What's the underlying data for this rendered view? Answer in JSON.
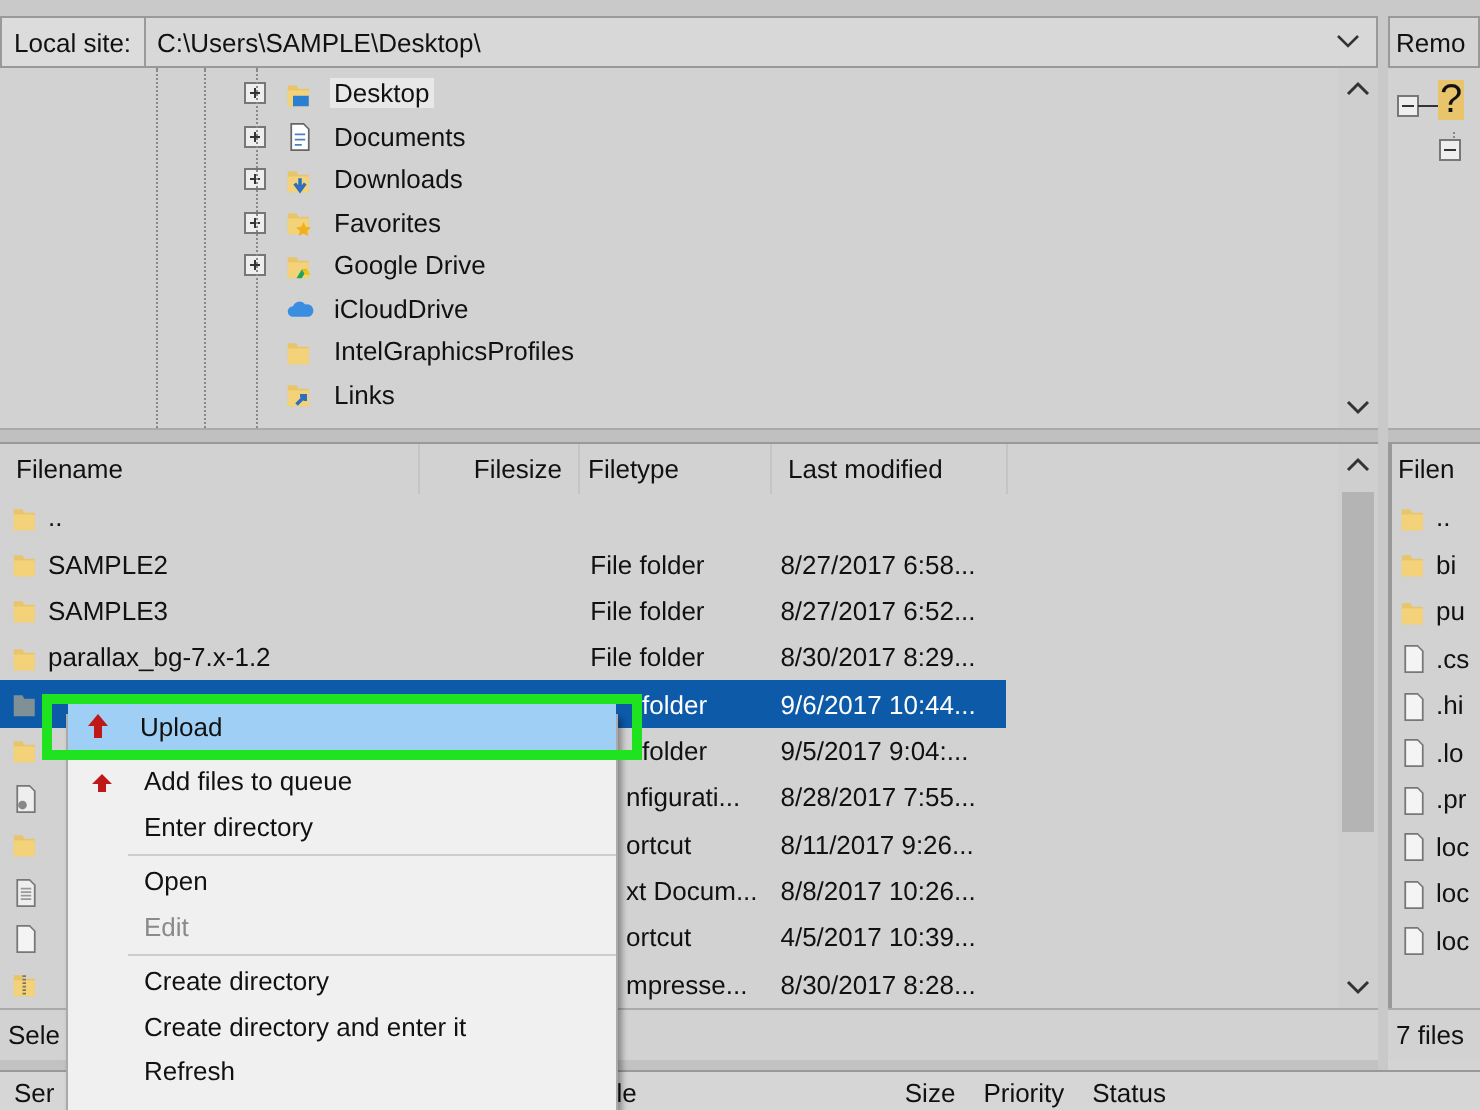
{
  "local_site": {
    "label": "Local site:",
    "path": "C:\\Users\\SAMPLE\\Desktop\\"
  },
  "local_tree": [
    {
      "label": "Desktop",
      "kind": "desktop",
      "expandable": true,
      "selected": true
    },
    {
      "label": "Documents",
      "kind": "documents",
      "expandable": true,
      "selected": false
    },
    {
      "label": "Downloads",
      "kind": "downloads",
      "expandable": true,
      "selected": false
    },
    {
      "label": "Favorites",
      "kind": "favorites",
      "expandable": true,
      "selected": false
    },
    {
      "label": "Google Drive",
      "kind": "drive",
      "expandable": true,
      "selected": false
    },
    {
      "label": "iCloudDrive",
      "kind": "cloud",
      "expandable": false,
      "selected": false
    },
    {
      "label": "IntelGraphicsProfiles",
      "kind": "folder",
      "expandable": false,
      "selected": false
    },
    {
      "label": "Links",
      "kind": "links",
      "expandable": false,
      "selected": false
    }
  ],
  "local_files": {
    "columns": [
      "Filename",
      "Filesize",
      "Filetype",
      "Last modified"
    ],
    "rows": [
      {
        "kind": "folder",
        "name": "..",
        "selected": false
      },
      {
        "kind": "folder",
        "name": "SAMPLE2",
        "filetype": "File folder",
        "modified": "8/27/2017 6:58...",
        "selected": false
      },
      {
        "kind": "folder",
        "name": "SAMPLE3",
        "filetype": "File folder",
        "modified": "8/27/2017 6:52...",
        "selected": false
      },
      {
        "kind": "folder",
        "name": "parallax_bg-7.x-1.2",
        "filetype": "File folder",
        "modified": "8/30/2017 8:29...",
        "selected": false
      },
      {
        "kind": "folder",
        "filetype": "folder",
        "modified": "9/6/2017 10:44...",
        "selected": true
      },
      {
        "kind": "folder",
        "filetype": "folder",
        "modified": "9/5/2017 9:04:...",
        "selected": false
      },
      {
        "kind": "config",
        "filetype": "nfigurati...",
        "modified": "8/28/2017 7:55...",
        "selected": false
      },
      {
        "kind": "folder",
        "filetype": "ortcut",
        "modified": "8/11/2017 9:26...",
        "selected": false
      },
      {
        "kind": "text",
        "filetype": "xt Docum...",
        "modified": "8/8/2017 10:26...",
        "selected": false
      },
      {
        "kind": "file",
        "filetype": "ortcut",
        "modified": "4/5/2017 10:39...",
        "selected": false
      },
      {
        "kind": "zip",
        "filetype": "mpresse...",
        "modified": "8/30/2017 8:28...",
        "selected": false
      }
    ],
    "status": "Sele"
  },
  "remote": {
    "site_label": "Remo",
    "tree_icon": "?",
    "column": "Filen",
    "rows": [
      {
        "kind": "folder",
        "name": ".."
      },
      {
        "kind": "folder",
        "name": "bi"
      },
      {
        "kind": "folder",
        "name": "pu"
      },
      {
        "kind": "file",
        "name": ".cs"
      },
      {
        "kind": "file",
        "name": ".hi"
      },
      {
        "kind": "file",
        "name": ".lo"
      },
      {
        "kind": "file",
        "name": ".pr"
      },
      {
        "kind": "file",
        "name": "loc"
      },
      {
        "kind": "file",
        "name": "loc"
      },
      {
        "kind": "file",
        "name": "loc"
      }
    ],
    "status": "7 files"
  },
  "queue_columns": [
    "Ser",
    "le",
    "Size",
    "Priority",
    "Status"
  ],
  "context_menu": [
    {
      "kind": "upload-item",
      "label": "Upload",
      "selected": true,
      "highlighted": true,
      "disabled": false
    },
    {
      "kind": "queue-item",
      "label": "Add files to queue",
      "selected": false,
      "disabled": false
    },
    {
      "kind": "item",
      "label": "Enter directory",
      "selected": false,
      "disabled": false
    },
    {
      "kind": "separator"
    },
    {
      "kind": "item",
      "label": "Open",
      "selected": false,
      "disabled": false
    },
    {
      "kind": "item",
      "label": "Edit",
      "selected": false,
      "disabled": true
    },
    {
      "kind": "separator"
    },
    {
      "kind": "item",
      "label": "Create directory",
      "selected": false,
      "disabled": false
    },
    {
      "kind": "item",
      "label": "Create directory and enter it",
      "selected": false,
      "disabled": false
    },
    {
      "kind": "item",
      "label": "Refresh",
      "selected": false,
      "disabled": false
    }
  ]
}
